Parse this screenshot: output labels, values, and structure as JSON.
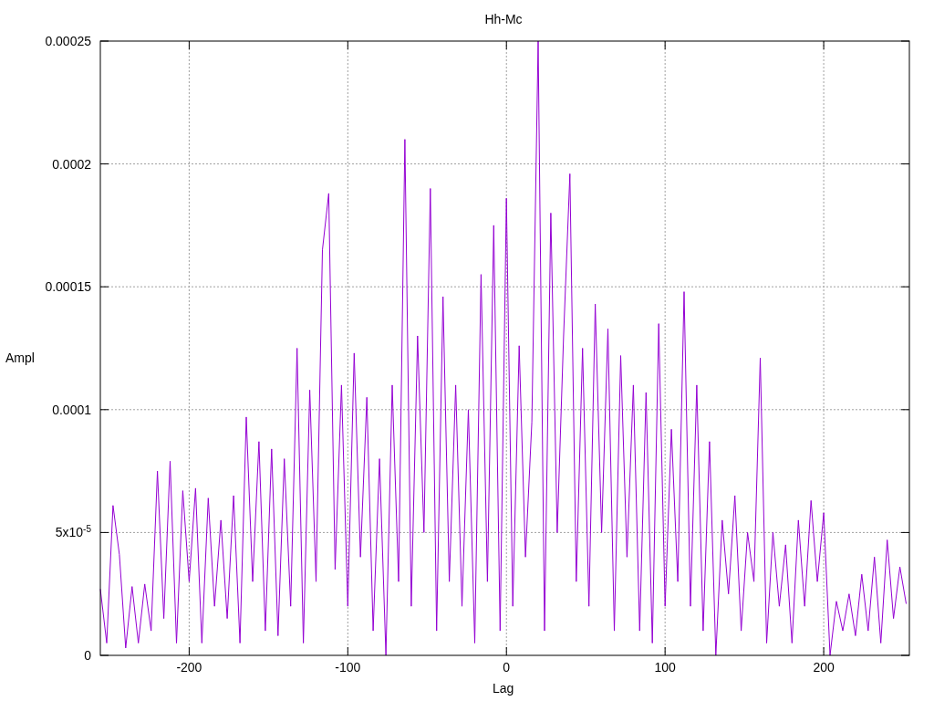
{
  "plot": {
    "chart_data": {
      "type": "line",
      "title": "Hh-Mc",
      "xlabel": "Lag",
      "ylabel": "Ampl",
      "xlim": [
        -256,
        254
      ],
      "ylim": [
        0,
        0.00025
      ],
      "grid": true,
      "xticks": [
        -200,
        -100,
        0,
        100,
        200
      ],
      "yticks": [
        {
          "value": 0,
          "label": "0"
        },
        {
          "value": 5e-05,
          "label": "5x10$^{-5}$"
        },
        {
          "value": 0.0001,
          "label": "0.0001"
        },
        {
          "value": 0.00015,
          "label": "0.00015"
        },
        {
          "value": 0.0002,
          "label": "0.0002"
        },
        {
          "value": 0.00025,
          "label": "0.00025"
        }
      ],
      "x": [
        -256,
        -252,
        -248,
        -244,
        -240,
        -236,
        -232,
        -228,
        -224,
        -220,
        -216,
        -212,
        -208,
        -204,
        -200,
        -196,
        -192,
        -188,
        -184,
        -180,
        -176,
        -172,
        -168,
        -164,
        -160,
        -156,
        -152,
        -148,
        -144,
        -140,
        -136,
        -132,
        -128,
        -124,
        -120,
        -116,
        -112,
        -108,
        -104,
        -100,
        -96,
        -92,
        -88,
        -84,
        -80,
        -76,
        -72,
        -68,
        -64,
        -60,
        -56,
        -52,
        -48,
        -44,
        -40,
        -36,
        -32,
        -28,
        -24,
        -20,
        -16,
        -12,
        -8,
        -4,
        0,
        4,
        8,
        12,
        16,
        20,
        24,
        28,
        32,
        36,
        40,
        44,
        48,
        52,
        56,
        60,
        64,
        68,
        72,
        76,
        80,
        84,
        88,
        92,
        96,
        100,
        104,
        108,
        112,
        116,
        120,
        124,
        128,
        132,
        136,
        140,
        144,
        148,
        152,
        156,
        160,
        164,
        168,
        172,
        176,
        180,
        184,
        188,
        192,
        196,
        200,
        204,
        208,
        212,
        216,
        220,
        224,
        228,
        232,
        236,
        240,
        244,
        248,
        252
      ],
      "series": [
        {
          "color": "#9400d3",
          "values": [
            2.7e-05,
            5e-06,
            6.1e-05,
            4.1e-05,
            3e-06,
            2.8e-05,
            5e-06,
            2.9e-05,
            1e-05,
            7.5e-05,
            1.5e-05,
            7.9e-05,
            5e-06,
            6.7e-05,
            3e-05,
            6.8e-05,
            5e-06,
            6.4e-05,
            2e-05,
            5.5e-05,
            1.5e-05,
            6.5e-05,
            5e-06,
            9.7e-05,
            3e-05,
            8.7e-05,
            1e-05,
            8.4e-05,
            8e-06,
            8e-05,
            2e-05,
            0.000125,
            5e-06,
            0.000108,
            3e-05,
            0.000165,
            0.000188,
            3.5e-05,
            0.00011,
            2e-05,
            0.000123,
            4e-05,
            0.000105,
            1e-05,
            8e-05,
            0,
            0.00011,
            3e-05,
            0.00021,
            2e-05,
            0.00013,
            5e-05,
            0.00019,
            1e-05,
            0.000146,
            3e-05,
            0.00011,
            2e-05,
            0.0001,
            5e-06,
            0.000155,
            3e-05,
            0.000175,
            1e-05,
            0.000186,
            2e-05,
            0.000126,
            4e-05,
            9.5e-05,
            0.00025,
            1e-05,
            0.00018,
            5e-05,
            0.00013,
            0.000196,
            3e-05,
            0.000125,
            2e-05,
            0.000143,
            5e-05,
            0.000133,
            1e-05,
            0.000122,
            4e-05,
            0.00011,
            1e-05,
            0.000107,
            5e-06,
            0.000135,
            2e-05,
            9.2e-05,
            3e-05,
            0.000148,
            2e-05,
            0.00011,
            1e-05,
            8.7e-05,
            0,
            5.5e-05,
            2.5e-05,
            6.5e-05,
            1e-05,
            5e-05,
            3e-05,
            0.000121,
            5e-06,
            5e-05,
            2e-05,
            4.5e-05,
            5e-06,
            5.5e-05,
            2e-05,
            6.3e-05,
            3e-05,
            5.8e-05,
            0,
            2.2e-05,
            1e-05,
            2.5e-05,
            8e-06,
            3.3e-05,
            1e-05,
            4e-05,
            5e-06,
            4.7e-05,
            1.5e-05,
            3.6e-05,
            2.1e-05
          ]
        }
      ]
    }
  }
}
